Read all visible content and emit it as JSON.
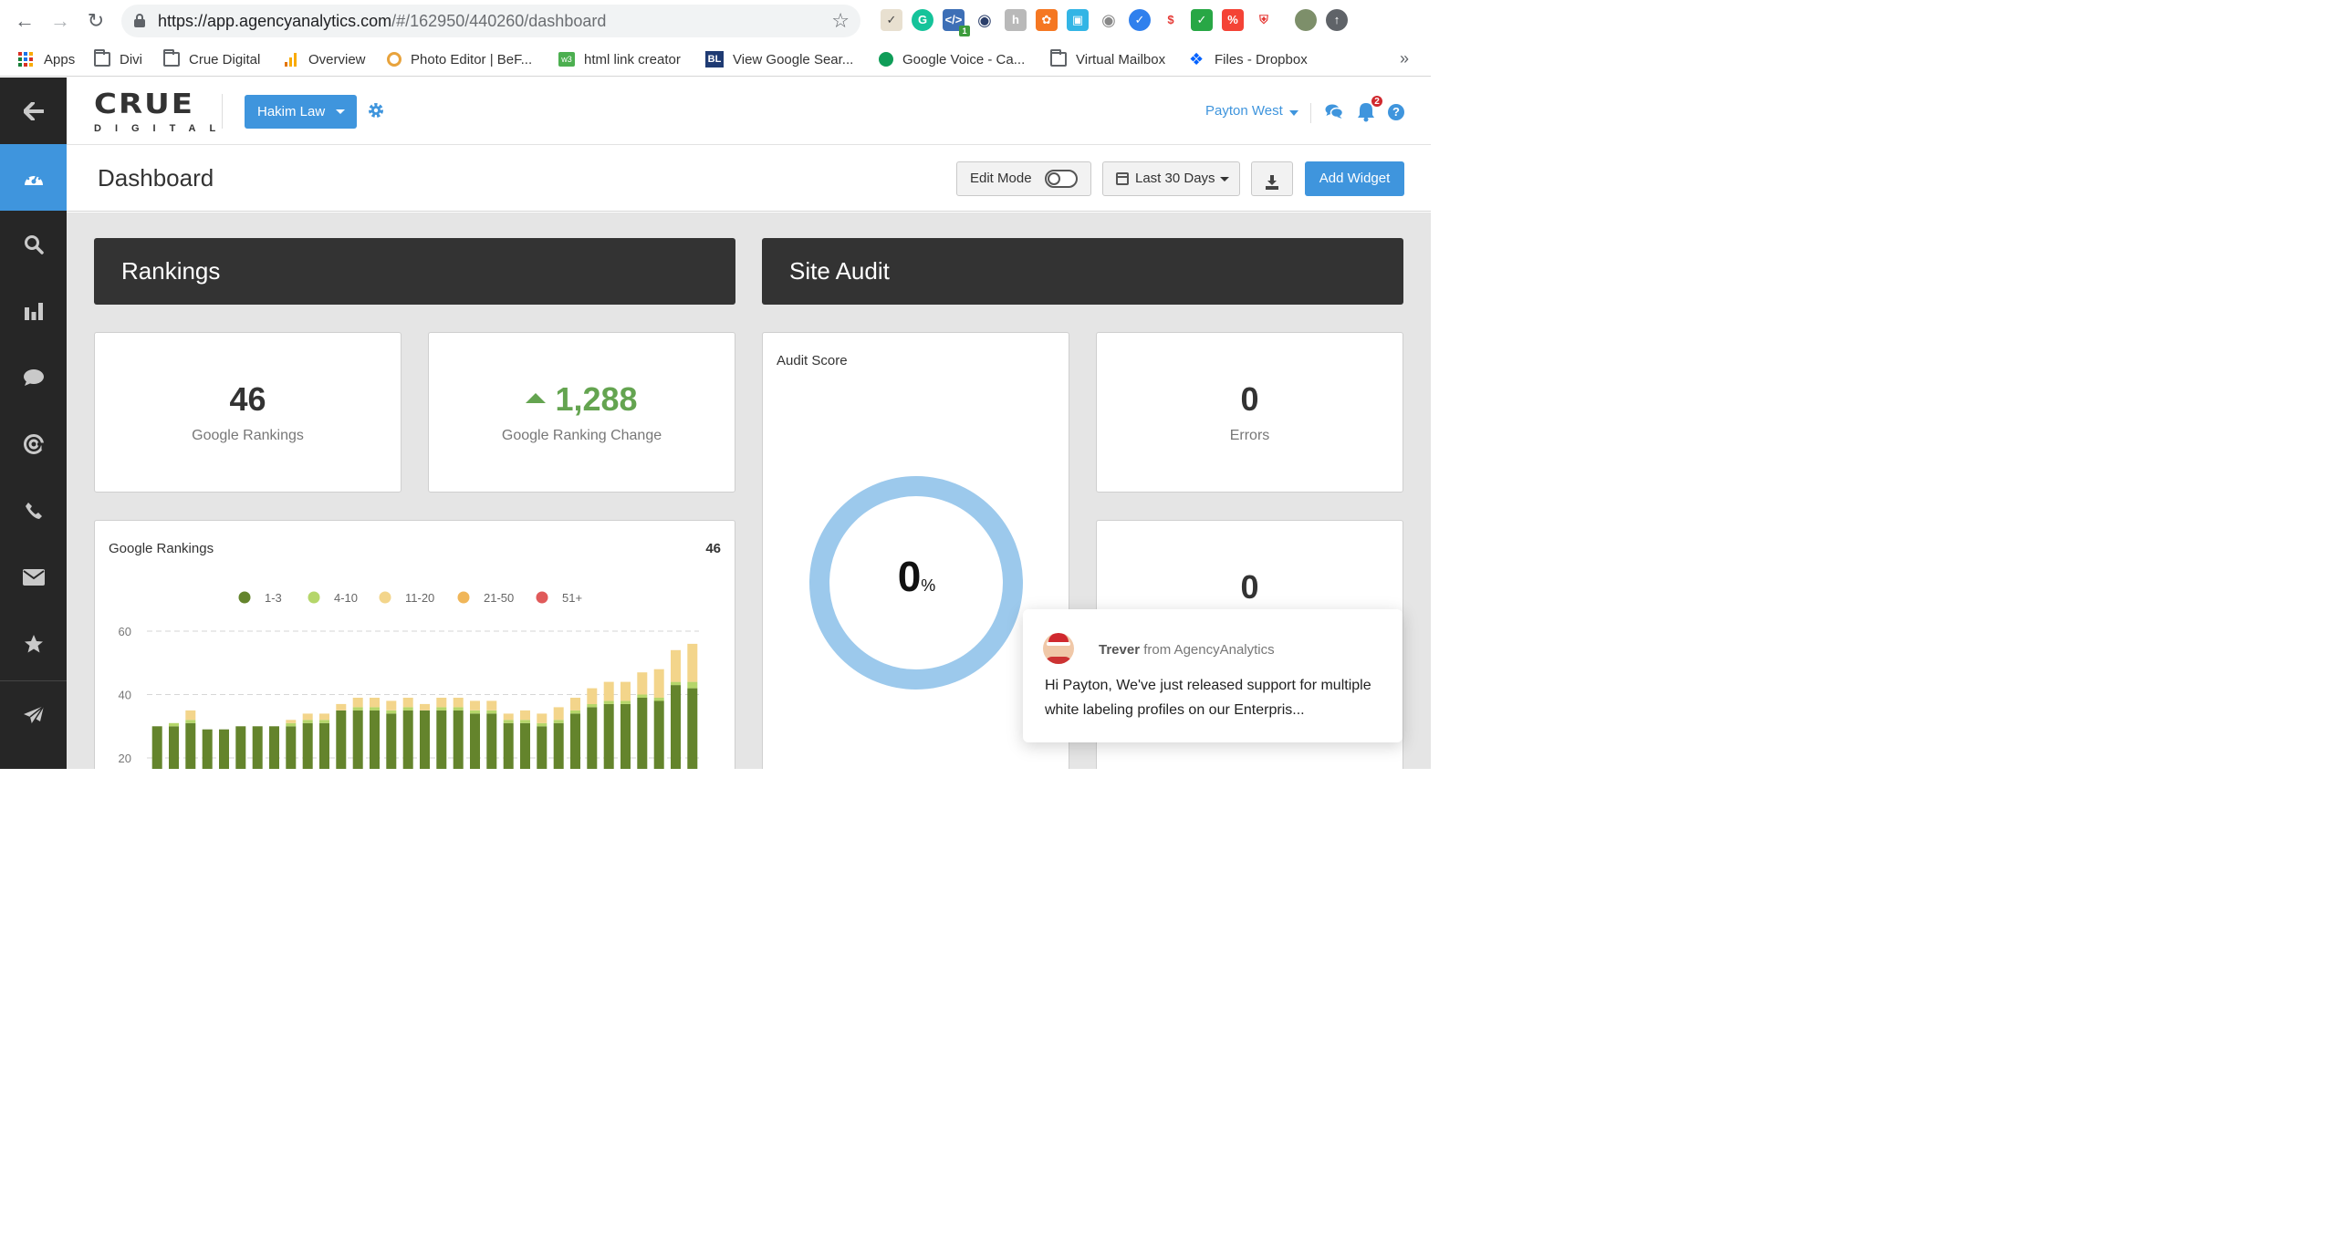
{
  "browser": {
    "url_host": "https://app.agencyanalytics.com",
    "url_path": "/#/162950/440260/dashboard",
    "bookmarks": [
      {
        "label": "Apps"
      },
      {
        "label": "Divi"
      },
      {
        "label": "Crue Digital"
      },
      {
        "label": "Overview"
      },
      {
        "label": "Photo Editor | BeF..."
      },
      {
        "label": "html link creator"
      },
      {
        "label": "View Google Sear..."
      },
      {
        "label": "Google Voice - Ca..."
      },
      {
        "label": "Virtual Mailbox"
      },
      {
        "label": "Files - Dropbox"
      }
    ],
    "extension_badge": "1"
  },
  "header": {
    "logo_main": "CRUE",
    "logo_sub": "DIGITAL",
    "client": "Hakim Law",
    "user": "Payton West",
    "notification_count": "2",
    "help": "?"
  },
  "toolbar": {
    "page_title": "Dashboard",
    "edit_mode": "Edit Mode",
    "date_range": "Last 30 Days",
    "add_widget": "Add Widget"
  },
  "rankings": {
    "section_title": "Rankings",
    "google_rankings_value": "46",
    "google_rankings_label": "Google Rankings",
    "change_value": "1,288",
    "change_label": "Google Ranking Change",
    "chart_title": "Google Rankings",
    "chart_total": "46"
  },
  "site_audit": {
    "section_title": "Site Audit",
    "audit_score_title": "Audit Score",
    "audit_score_value": "0",
    "audit_score_unit": "%",
    "errors_value": "0",
    "errors_label": "Errors",
    "second_value": "0"
  },
  "chat": {
    "sender": "Trever",
    "from_text": "from AgencyAnalytics",
    "message": "Hi Payton, We've just released support for multiple white labeling profiles on our Enterpris..."
  },
  "colors": {
    "accent": "#3f95dd",
    "sidebar": "#262626",
    "rank_1_3": "#64842c",
    "rank_4_10": "#b5d66a",
    "rank_11_20": "#f3d58b",
    "rank_21_50": "#f0b659",
    "rank_51_plus": "#e05a5a",
    "donut": "#9cc9ec"
  },
  "chart_data": {
    "type": "bar",
    "stacked": true,
    "title": "Google Rankings",
    "legend_position": "top",
    "grid": true,
    "ylim": [
      0,
      60
    ],
    "y_ticks": [
      20,
      40,
      60
    ],
    "series": [
      {
        "name": "1-3",
        "color": "#64842c",
        "values": [
          30,
          30,
          31,
          29,
          29,
          30,
          30,
          30,
          30,
          31,
          31,
          35,
          35,
          35,
          34,
          35,
          35,
          35,
          35,
          34,
          34,
          31,
          31,
          30,
          31,
          34,
          36,
          37,
          37,
          39,
          38,
          43,
          42
        ]
      },
      {
        "name": "4-10",
        "color": "#b5d66a",
        "values": [
          0,
          1,
          1,
          0,
          0,
          0,
          0,
          0,
          1,
          1,
          1,
          0,
          1,
          1,
          1,
          1,
          0,
          1,
          1,
          1,
          1,
          1,
          1,
          1,
          1,
          1,
          1,
          1,
          1,
          1,
          1,
          1,
          2
        ]
      },
      {
        "name": "11-20",
        "color": "#f3d58b",
        "values": [
          0,
          0,
          3,
          0,
          0,
          0,
          0,
          0,
          1,
          2,
          2,
          2,
          3,
          3,
          3,
          3,
          2,
          3,
          3,
          3,
          3,
          2,
          3,
          3,
          4,
          4,
          5,
          6,
          6,
          7,
          9,
          10,
          12
        ]
      },
      {
        "name": "21-50",
        "color": "#f0b659",
        "values": []
      },
      {
        "name": "51+",
        "color": "#e05a5a",
        "values": []
      }
    ]
  }
}
